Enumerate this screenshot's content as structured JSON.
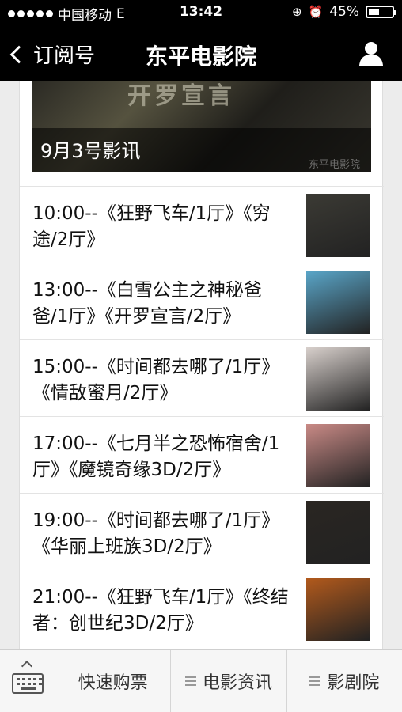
{
  "status_bar": {
    "carrier": "中国移动",
    "network": "E",
    "time": "13:42",
    "battery_percent": "45%",
    "battery_level": 0.45
  },
  "nav": {
    "back_label": "订阅号",
    "title": "东平电影院",
    "profile_icon": "person-icon"
  },
  "banner": {
    "caption": "9月3号影讯",
    "poster_text": "开罗宣言",
    "watermark": "东平电影院"
  },
  "schedule": [
    {
      "text": "10:00--《狂野飞车/1厅》《穷途/2厅》",
      "thumb_color": "#3b3a34"
    },
    {
      "text": "13:00--《白雪公主之神秘爸爸/1厅》《开罗宣言/2厅》",
      "thumb_color": "#5aa6c9"
    },
    {
      "text": "15:00--《时间都去哪了/1厅》《情敌蜜月/2厅》",
      "thumb_color": "#d8d0cc"
    },
    {
      "text": "17:00--《七月半之恐怖宿舍/1厅》《魔镜奇缘3D/2厅》",
      "thumb_color": "#c98a86"
    },
    {
      "text": "19:00--《时间都去哪了/1厅》《华丽上班族3D/2厅》",
      "thumb_color": "#2a2622"
    },
    {
      "text": "21:00--《狂野飞车/1厅》《终结者：创世纪3D/2厅》",
      "thumb_color": "#b35a1c"
    }
  ],
  "bottom_menu": {
    "keyboard_icon": "keyboard-icon",
    "items": [
      {
        "label": "快速购票",
        "has_menu_icon": false
      },
      {
        "label": "电影资讯",
        "has_menu_icon": true
      },
      {
        "label": "影剧院",
        "has_menu_icon": true
      }
    ]
  }
}
